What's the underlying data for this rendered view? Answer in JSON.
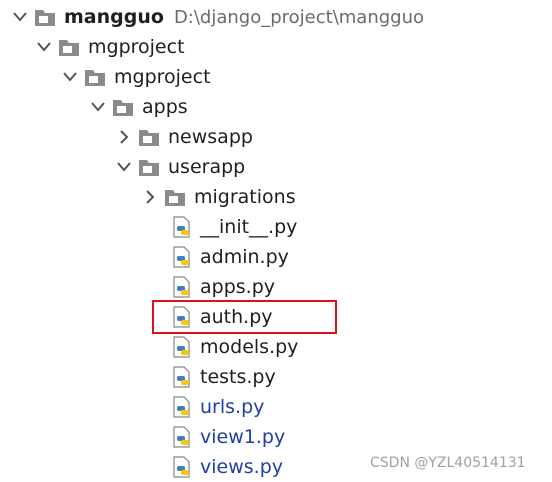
{
  "project_tree": {
    "root": {
      "name": "mangguo",
      "path": "D:\\django_project\\mangguo"
    },
    "mgproject_outer": "mgproject",
    "mgproject_inner": "mgproject",
    "apps": "apps",
    "newsapp": "newsapp",
    "userapp": "userapp",
    "migrations": "migrations",
    "files": [
      {
        "name": "__init__.py"
      },
      {
        "name": "admin.py"
      },
      {
        "name": "apps.py"
      },
      {
        "name": "auth.py",
        "highlighted": true
      },
      {
        "name": "models.py"
      },
      {
        "name": "tests.py"
      },
      {
        "name": "urls.py",
        "vcs_status": "new"
      },
      {
        "name": "view1.py",
        "vcs_status": "new"
      },
      {
        "name": "views.py",
        "vcs_status": "new"
      }
    ]
  },
  "colors": {
    "folder": "#8a8a8a",
    "new_file_text": "#1f3ea8",
    "highlight_border": "#d9121b",
    "python_blue": "#3f7fc0",
    "python_yellow": "#f5c518"
  },
  "watermark": "CSDN @YZL40514131"
}
